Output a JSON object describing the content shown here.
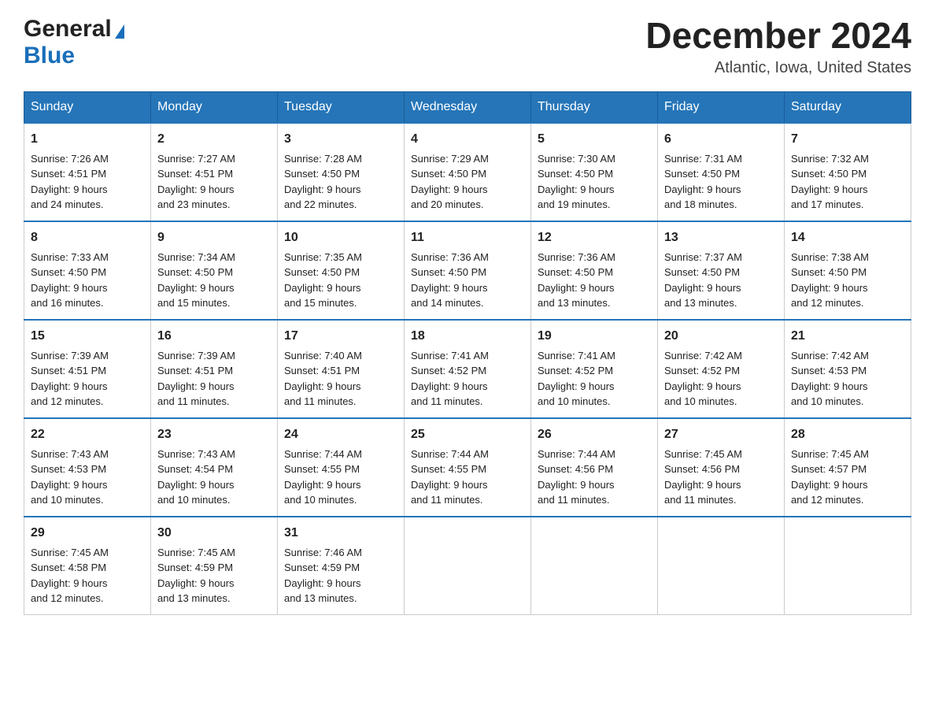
{
  "header": {
    "logo_general": "General",
    "logo_blue": "Blue",
    "month_title": "December 2024",
    "location": "Atlantic, Iowa, United States"
  },
  "weekdays": [
    "Sunday",
    "Monday",
    "Tuesday",
    "Wednesday",
    "Thursday",
    "Friday",
    "Saturday"
  ],
  "weeks": [
    [
      {
        "day": "1",
        "sunrise": "7:26 AM",
        "sunset": "4:51 PM",
        "daylight": "9 hours and 24 minutes."
      },
      {
        "day": "2",
        "sunrise": "7:27 AM",
        "sunset": "4:51 PM",
        "daylight": "9 hours and 23 minutes."
      },
      {
        "day": "3",
        "sunrise": "7:28 AM",
        "sunset": "4:50 PM",
        "daylight": "9 hours and 22 minutes."
      },
      {
        "day": "4",
        "sunrise": "7:29 AM",
        "sunset": "4:50 PM",
        "daylight": "9 hours and 20 minutes."
      },
      {
        "day": "5",
        "sunrise": "7:30 AM",
        "sunset": "4:50 PM",
        "daylight": "9 hours and 19 minutes."
      },
      {
        "day": "6",
        "sunrise": "7:31 AM",
        "sunset": "4:50 PM",
        "daylight": "9 hours and 18 minutes."
      },
      {
        "day": "7",
        "sunrise": "7:32 AM",
        "sunset": "4:50 PM",
        "daylight": "9 hours and 17 minutes."
      }
    ],
    [
      {
        "day": "8",
        "sunrise": "7:33 AM",
        "sunset": "4:50 PM",
        "daylight": "9 hours and 16 minutes."
      },
      {
        "day": "9",
        "sunrise": "7:34 AM",
        "sunset": "4:50 PM",
        "daylight": "9 hours and 15 minutes."
      },
      {
        "day": "10",
        "sunrise": "7:35 AM",
        "sunset": "4:50 PM",
        "daylight": "9 hours and 15 minutes."
      },
      {
        "day": "11",
        "sunrise": "7:36 AM",
        "sunset": "4:50 PM",
        "daylight": "9 hours and 14 minutes."
      },
      {
        "day": "12",
        "sunrise": "7:36 AM",
        "sunset": "4:50 PM",
        "daylight": "9 hours and 13 minutes."
      },
      {
        "day": "13",
        "sunrise": "7:37 AM",
        "sunset": "4:50 PM",
        "daylight": "9 hours and 13 minutes."
      },
      {
        "day": "14",
        "sunrise": "7:38 AM",
        "sunset": "4:50 PM",
        "daylight": "9 hours and 12 minutes."
      }
    ],
    [
      {
        "day": "15",
        "sunrise": "7:39 AM",
        "sunset": "4:51 PM",
        "daylight": "9 hours and 12 minutes."
      },
      {
        "day": "16",
        "sunrise": "7:39 AM",
        "sunset": "4:51 PM",
        "daylight": "9 hours and 11 minutes."
      },
      {
        "day": "17",
        "sunrise": "7:40 AM",
        "sunset": "4:51 PM",
        "daylight": "9 hours and 11 minutes."
      },
      {
        "day": "18",
        "sunrise": "7:41 AM",
        "sunset": "4:52 PM",
        "daylight": "9 hours and 11 minutes."
      },
      {
        "day": "19",
        "sunrise": "7:41 AM",
        "sunset": "4:52 PM",
        "daylight": "9 hours and 10 minutes."
      },
      {
        "day": "20",
        "sunrise": "7:42 AM",
        "sunset": "4:52 PM",
        "daylight": "9 hours and 10 minutes."
      },
      {
        "day": "21",
        "sunrise": "7:42 AM",
        "sunset": "4:53 PM",
        "daylight": "9 hours and 10 minutes."
      }
    ],
    [
      {
        "day": "22",
        "sunrise": "7:43 AM",
        "sunset": "4:53 PM",
        "daylight": "9 hours and 10 minutes."
      },
      {
        "day": "23",
        "sunrise": "7:43 AM",
        "sunset": "4:54 PM",
        "daylight": "9 hours and 10 minutes."
      },
      {
        "day": "24",
        "sunrise": "7:44 AM",
        "sunset": "4:55 PM",
        "daylight": "9 hours and 10 minutes."
      },
      {
        "day": "25",
        "sunrise": "7:44 AM",
        "sunset": "4:55 PM",
        "daylight": "9 hours and 11 minutes."
      },
      {
        "day": "26",
        "sunrise": "7:44 AM",
        "sunset": "4:56 PM",
        "daylight": "9 hours and 11 minutes."
      },
      {
        "day": "27",
        "sunrise": "7:45 AM",
        "sunset": "4:56 PM",
        "daylight": "9 hours and 11 minutes."
      },
      {
        "day": "28",
        "sunrise": "7:45 AM",
        "sunset": "4:57 PM",
        "daylight": "9 hours and 12 minutes."
      }
    ],
    [
      {
        "day": "29",
        "sunrise": "7:45 AM",
        "sunset": "4:58 PM",
        "daylight": "9 hours and 12 minutes."
      },
      {
        "day": "30",
        "sunrise": "7:45 AM",
        "sunset": "4:59 PM",
        "daylight": "9 hours and 13 minutes."
      },
      {
        "day": "31",
        "sunrise": "7:46 AM",
        "sunset": "4:59 PM",
        "daylight": "9 hours and 13 minutes."
      },
      null,
      null,
      null,
      null
    ]
  ],
  "labels": {
    "sunrise": "Sunrise:",
    "sunset": "Sunset:",
    "daylight": "Daylight:"
  },
  "colors": {
    "header_bg": "#2575b8",
    "border_blue": "#2575b8",
    "logo_blue": "#1a6fba"
  }
}
